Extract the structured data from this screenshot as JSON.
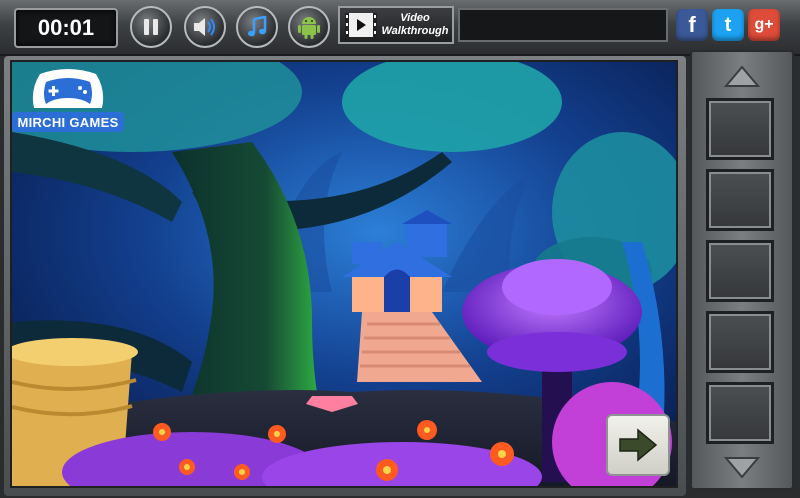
{
  "hud": {
    "timer": "00:01",
    "video_walkthrough_line1": "Video",
    "video_walkthrough_line2": "Walkthrough"
  },
  "social": {
    "facebook": "f",
    "twitter": "t",
    "googleplus": "g+"
  },
  "logo": {
    "text": "MIRCHI GAMES"
  },
  "buttons": [
    "pause-button",
    "sound-button",
    "music-button",
    "android-button",
    "next-arrow-button"
  ],
  "inventory": {
    "slot_count": 5
  },
  "colors": {
    "facebook": "#3b5998",
    "twitter": "#1da1f2",
    "googleplus": "#dd4b39",
    "logo_blue": "#2b6fd6",
    "scene_sky": "#0f2a6b"
  },
  "icons": [
    "pause-icon",
    "speaker-icon",
    "music-note-icon",
    "android-icon",
    "film-icon",
    "arrow-right-icon",
    "arrow-up-icon",
    "arrow-down-icon"
  ]
}
